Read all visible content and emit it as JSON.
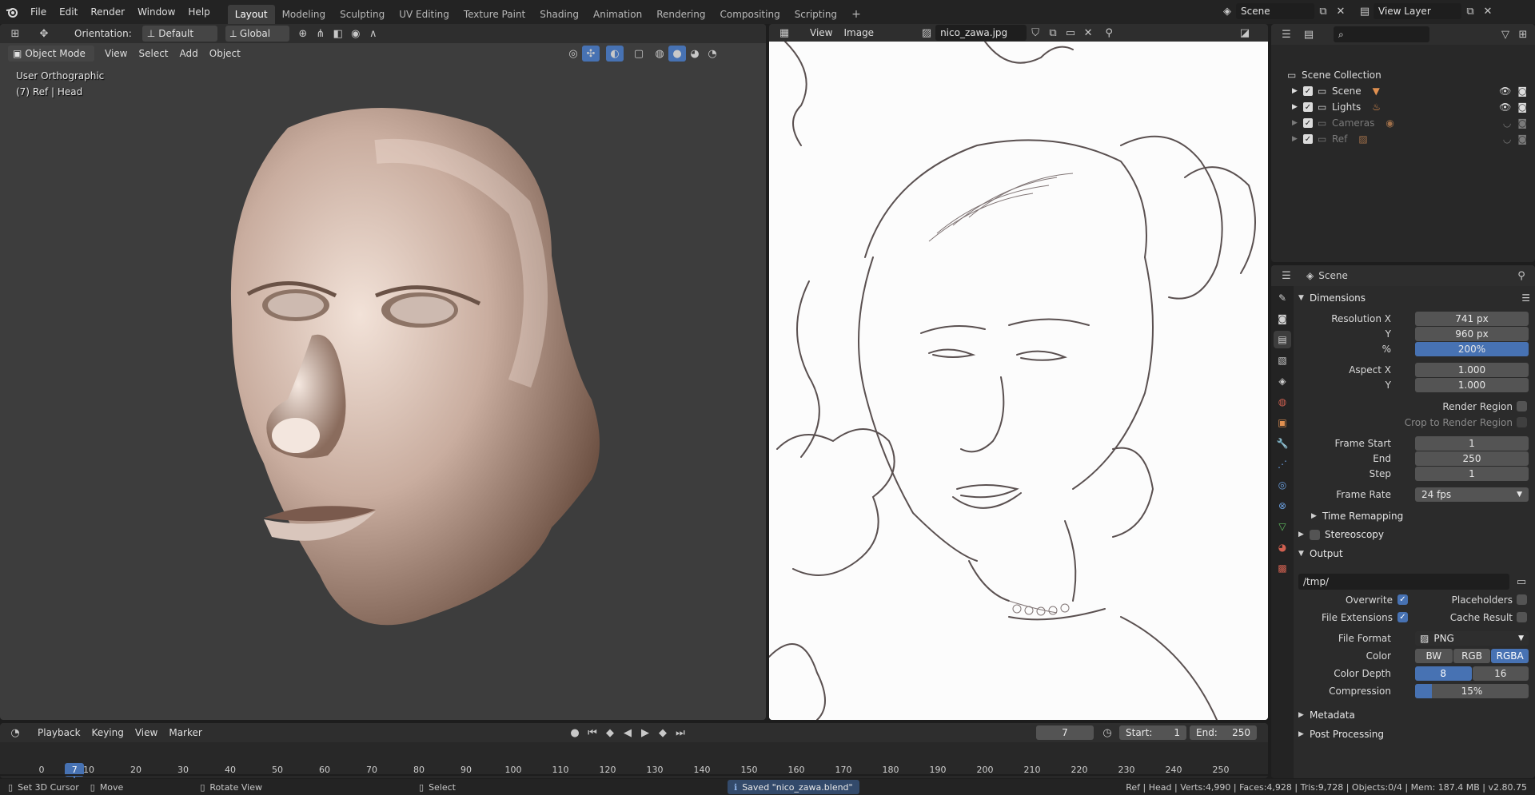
{
  "topbar": {
    "menus": [
      "File",
      "Edit",
      "Render",
      "Window",
      "Help"
    ],
    "workspaces": [
      "Layout",
      "Modeling",
      "Sculpting",
      "UV Editing",
      "Texture Paint",
      "Shading",
      "Animation",
      "Rendering",
      "Compositing",
      "Scripting"
    ],
    "active_workspace": "Layout",
    "add_workspace": "+",
    "scene_name": "Scene",
    "view_layer": "View Layer"
  },
  "viewport": {
    "orientation_label": "Orientation:",
    "orientation_value": "Default",
    "transform_space": "Global",
    "mode": "Object Mode",
    "menus": [
      "View",
      "Select",
      "Add",
      "Object"
    ],
    "overlay_title": "User Orthographic",
    "overlay_object": "(7) Ref | Head"
  },
  "image_editor": {
    "menus": [
      "View",
      "Image"
    ],
    "image_name": "nico_zawa.jpg"
  },
  "outliner": {
    "root": "Scene Collection",
    "collections": [
      {
        "name": "Scene",
        "dim": false
      },
      {
        "name": "Lights",
        "dim": false
      },
      {
        "name": "Cameras",
        "dim": true
      },
      {
        "name": "Ref",
        "dim": true
      }
    ]
  },
  "properties": {
    "context": "Scene",
    "dimensions_title": "Dimensions",
    "resolution_x_label": "Resolution X",
    "resolution_x": "741 px",
    "resolution_y_label": "Y",
    "resolution_y": "960 px",
    "percent_label": "%",
    "percent": "200%",
    "percent_fraction": 1.0,
    "aspect_x_label": "Aspect X",
    "aspect_x": "1.000",
    "aspect_y_label": "Y",
    "aspect_y": "1.000",
    "render_region": "Render Region",
    "crop_region": "Crop to Render Region",
    "frame_start_label": "Frame Start",
    "frame_start": "1",
    "frame_end_label": "End",
    "frame_end": "250",
    "frame_step_label": "Step",
    "frame_step": "1",
    "frame_rate_label": "Frame Rate",
    "frame_rate": "24 fps",
    "time_remapping": "Time Remapping",
    "stereoscopy": "Stereoscopy",
    "output_title": "Output",
    "output_path": "/tmp/",
    "overwrite": "Overwrite",
    "placeholders": "Placeholders",
    "file_extensions": "File Extensions",
    "cache_result": "Cache Result",
    "file_format_label": "File Format",
    "file_format": "PNG",
    "color_label": "Color",
    "color_options": [
      "BW",
      "RGB",
      "RGBA"
    ],
    "color_selected": "RGBA",
    "color_depth_label": "Color Depth",
    "color_depth_options": [
      "8",
      "16"
    ],
    "color_depth_selected": "8",
    "compression_label": "Compression",
    "compression": "15%",
    "compression_fraction": 0.15,
    "metadata": "Metadata",
    "post_processing": "Post Processing"
  },
  "timeline": {
    "menus": [
      "Playback",
      "Keying",
      "View",
      "Marker"
    ],
    "current_frame": "7",
    "start_label": "Start:",
    "start": "1",
    "end_label": "End:",
    "end": "250",
    "ticks": [
      "0",
      "10",
      "20",
      "30",
      "40",
      "50",
      "60",
      "70",
      "80",
      "90",
      "100",
      "110",
      "120",
      "130",
      "140",
      "150",
      "160",
      "170",
      "180",
      "190",
      "200",
      "210",
      "220",
      "230",
      "240",
      "250"
    ]
  },
  "statusbar": {
    "hint1": "Set 3D Cursor",
    "hint2": "Move",
    "hint3": "Rotate View",
    "hint4": "Select",
    "message": "Saved \"nico_zawa.blend\"",
    "stats": "Ref | Head | Verts:4,990 | Faces:4,928 | Tris:9,728 | Objects:0/4 | Mem: 187.4 MB | v2.80.75"
  },
  "colors": {
    "accent": "#4772b3",
    "background": "#3d3d3d"
  }
}
